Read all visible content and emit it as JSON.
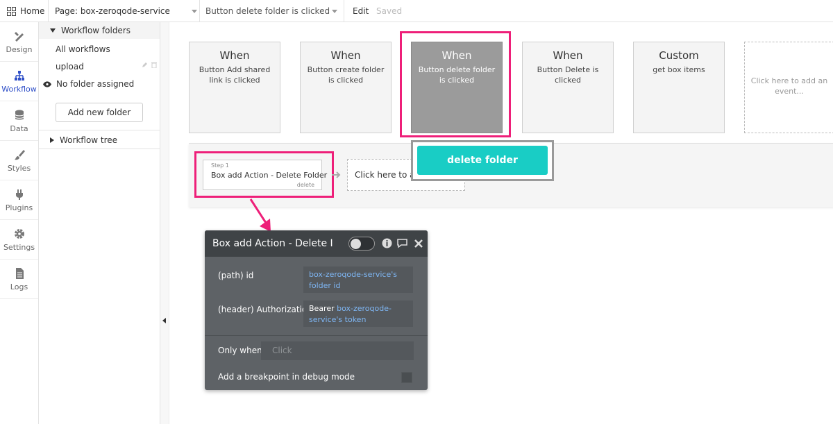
{
  "topbar": {
    "home": "Home",
    "page": "Page: box-zeroqode-service",
    "event": "Button delete folder is clicked",
    "edit": "Edit",
    "saved": "Saved"
  },
  "nav": {
    "design": "Design",
    "workflow": "Workflow",
    "data": "Data",
    "styles": "Styles",
    "plugins": "Plugins",
    "settings": "Settings",
    "logs": "Logs"
  },
  "panel": {
    "folders_header": "Workflow folders",
    "all_workflows": "All workflows",
    "upload": "upload",
    "no_folder": "No folder assigned",
    "add_folder": "Add new folder",
    "tree_header": "Workflow tree"
  },
  "events": [
    {
      "heading": "When",
      "text": "Button Add shared link is clicked"
    },
    {
      "heading": "When",
      "text": "Button create folder is clicked"
    },
    {
      "heading": "When",
      "text": "Button delete folder is clicked"
    },
    {
      "heading": "When",
      "text": "Button Delete is clicked"
    },
    {
      "heading": "Custom",
      "text": "get box items"
    },
    {
      "heading": "",
      "text": "Click here to add an event..."
    }
  ],
  "tooltip": {
    "label": "delete folder"
  },
  "step": {
    "number": "Step 1",
    "title": "Box add Action - Delete Folder",
    "action": "delete",
    "add_placeholder": "Click here to ad"
  },
  "editor": {
    "title": "Box add Action - Delete I",
    "path_label": "(path) id",
    "path_value": "box-zeroqode-service's folder id",
    "header_label": "(header) Authorizatio",
    "header_prefix": "Bearer ",
    "header_value": "box-zeroqode-service's token",
    "only_when_label": "Only when",
    "only_when_placeholder": "Click",
    "breakpoint_label": "Add a breakpoint in debug mode"
  },
  "colors": {
    "highlight": "#ee1f79",
    "teal": "#19cdc5",
    "active_nav": "#3050c8",
    "link": "#7fb7f5"
  }
}
